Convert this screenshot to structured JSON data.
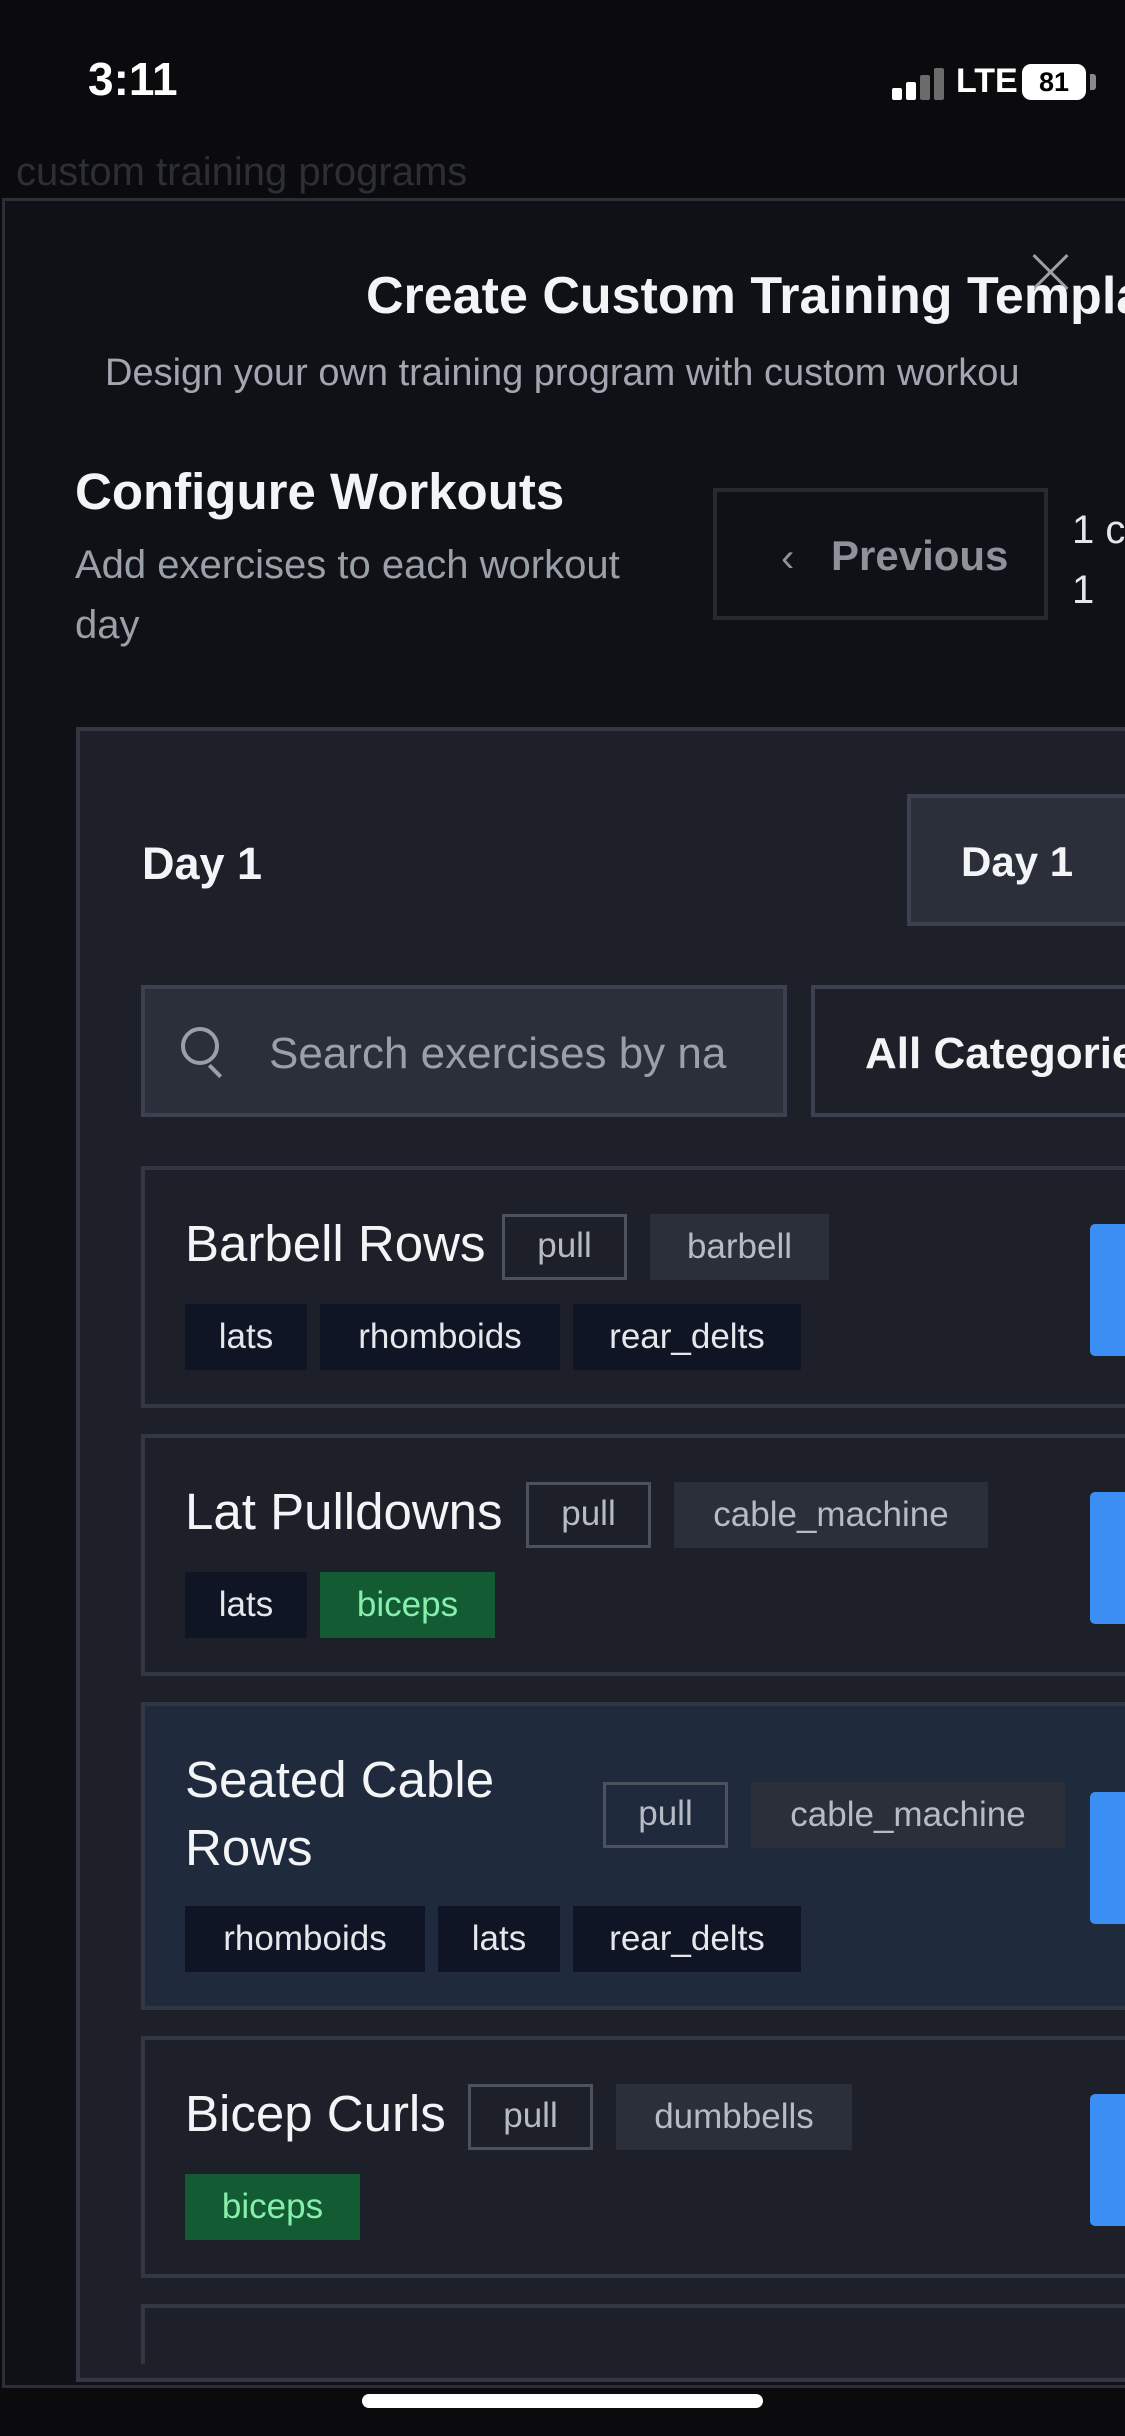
{
  "status": {
    "time": "3:11",
    "network": "LTE",
    "battery": "81"
  },
  "background": {
    "title": "custom training programs"
  },
  "modal": {
    "title": "Create Custom Training Templat",
    "description": "Design your own training program with custom workou",
    "step": {
      "title": "Configure Workouts",
      "description": "Add exercises to each workout day",
      "previous_label": "Previous",
      "progress_lines": [
        "1 c",
        "1"
      ]
    },
    "day": {
      "title": "Day 1",
      "selected_day": "Day 1",
      "search_placeholder": "Search exercises by na",
      "category_filter": "All Categorie"
    },
    "exercises": [
      {
        "name": "Barbell Rows",
        "category": "pull",
        "equipment": "barbell",
        "muscles": [
          "lats",
          "rhomboids",
          "rear_delts"
        ],
        "selected": false
      },
      {
        "name": "Lat Pulldowns",
        "category": "pull",
        "equipment": "cable_machine",
        "muscles": [
          "lats",
          "biceps"
        ],
        "highlighted_muscle": "biceps",
        "selected": false
      },
      {
        "name": "Seated Cable Rows",
        "category": "pull",
        "equipment": "cable_machine",
        "muscles": [
          "rhomboids",
          "lats",
          "rear_delts"
        ],
        "selected": true
      },
      {
        "name": "Bicep Curls",
        "category": "pull",
        "equipment": "dumbbells",
        "muscles": [
          "biceps"
        ],
        "highlighted_muscle": "biceps",
        "selected": false
      }
    ]
  },
  "colors": {
    "accent": "#3b8ef3",
    "muscle_highlight_bg": "#135c33",
    "muscle_highlight_text": "#86efac",
    "panel_bg": "#1d2029",
    "selected_card_bg": "#1f2a3c"
  },
  "icons": [
    "close-icon",
    "chevron-left-icon",
    "search-icon",
    "signal-icon",
    "battery-icon"
  ]
}
